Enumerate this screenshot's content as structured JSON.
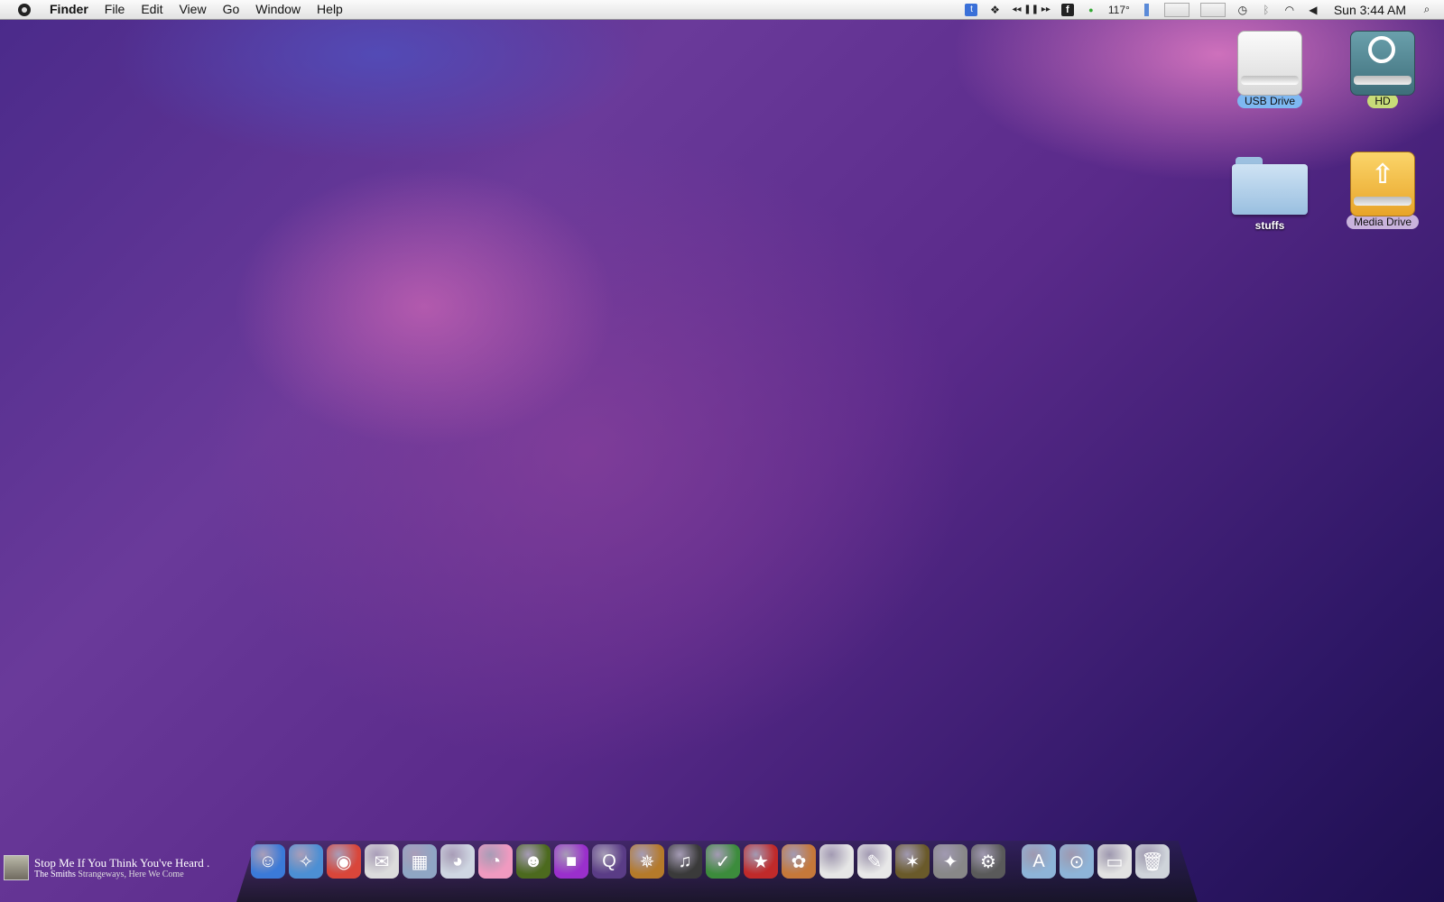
{
  "menubar": {
    "app": "Finder",
    "items": [
      "File",
      "Edit",
      "View",
      "Go",
      "Window",
      "Help"
    ],
    "temperature": "117°",
    "clock": "Sun 3:44 AM"
  },
  "desktop": {
    "icons": [
      {
        "label": "USB Drive",
        "type": "usb-drive-icon",
        "label_color": "#7eb8f2"
      },
      {
        "label": "HD",
        "type": "time-machine-drive-icon",
        "label_color": "#c8dc78"
      },
      {
        "label": "stuffs",
        "type": "folder-icon"
      },
      {
        "label": "Media Drive",
        "type": "usb-media-drive-icon",
        "label_color": "#c9b3dc"
      }
    ]
  },
  "now_playing": {
    "title": "Stop Me If You Think You've Heard .",
    "artist": "The Smiths",
    "album": "Strangeways, Here We Come"
  },
  "dock": {
    "apps": [
      {
        "name": "finder-icon",
        "glyph": "☺",
        "color": "#3b7ad8"
      },
      {
        "name": "safari-icon",
        "glyph": "✧",
        "color": "#4c8fd4"
      },
      {
        "name": "chrome-icon",
        "glyph": "◉",
        "color": "#d9463a"
      },
      {
        "name": "mail-icon",
        "glyph": "✉",
        "color": "#dcdcdc"
      },
      {
        "name": "preview-icon",
        "glyph": "▦",
        "color": "#8fa6c4"
      },
      {
        "name": "panda-app-icon",
        "glyph": "◕",
        "color": "#cfd6e2"
      },
      {
        "name": "pig-app-icon",
        "glyph": "◔",
        "color": "#f09ac0"
      },
      {
        "name": "contacts-icon",
        "glyph": "☻",
        "color": "#4c6a1e"
      },
      {
        "name": "purple-square-app-icon",
        "glyph": "■",
        "color": "#9a2fcc"
      },
      {
        "name": "quicktime-icon",
        "glyph": "Q",
        "color": "#5a3c86"
      },
      {
        "name": "helm-app-icon",
        "glyph": "✵",
        "color": "#b57a2a"
      },
      {
        "name": "headphones-app-icon",
        "glyph": "♫",
        "color": "#3a3a3a"
      },
      {
        "name": "globe-app-icon",
        "glyph": "✓",
        "color": "#3c8c3c"
      },
      {
        "name": "captain-america-shield-icon",
        "glyph": "★",
        "color": "#c02a2a"
      },
      {
        "name": "photo-app-icon",
        "glyph": "✿",
        "color": "#c6783a"
      },
      {
        "name": "apple-doc-icon",
        "glyph": "",
        "color": "#e6e6e6"
      },
      {
        "name": "textedit-icon",
        "glyph": "✎",
        "color": "#e8e8e8"
      },
      {
        "name": "star-app-icon",
        "glyph": "✶",
        "color": "#6a5a2a"
      },
      {
        "name": "counter-strike-icon",
        "glyph": "✦",
        "color": "#888888"
      },
      {
        "name": "steam-icon",
        "glyph": "⚙",
        "color": "#5a5a5a"
      }
    ],
    "folders": [
      {
        "name": "applications-folder-icon",
        "glyph": "A",
        "color": "#8eb4d8"
      },
      {
        "name": "downloads-folder-icon",
        "glyph": "⊙",
        "color": "#8eb4d8"
      },
      {
        "name": "document-stack-icon",
        "glyph": "▭",
        "color": "#e2e2e2"
      },
      {
        "name": "trash-icon",
        "glyph": "🗑",
        "color": "#cfd4da"
      }
    ]
  }
}
